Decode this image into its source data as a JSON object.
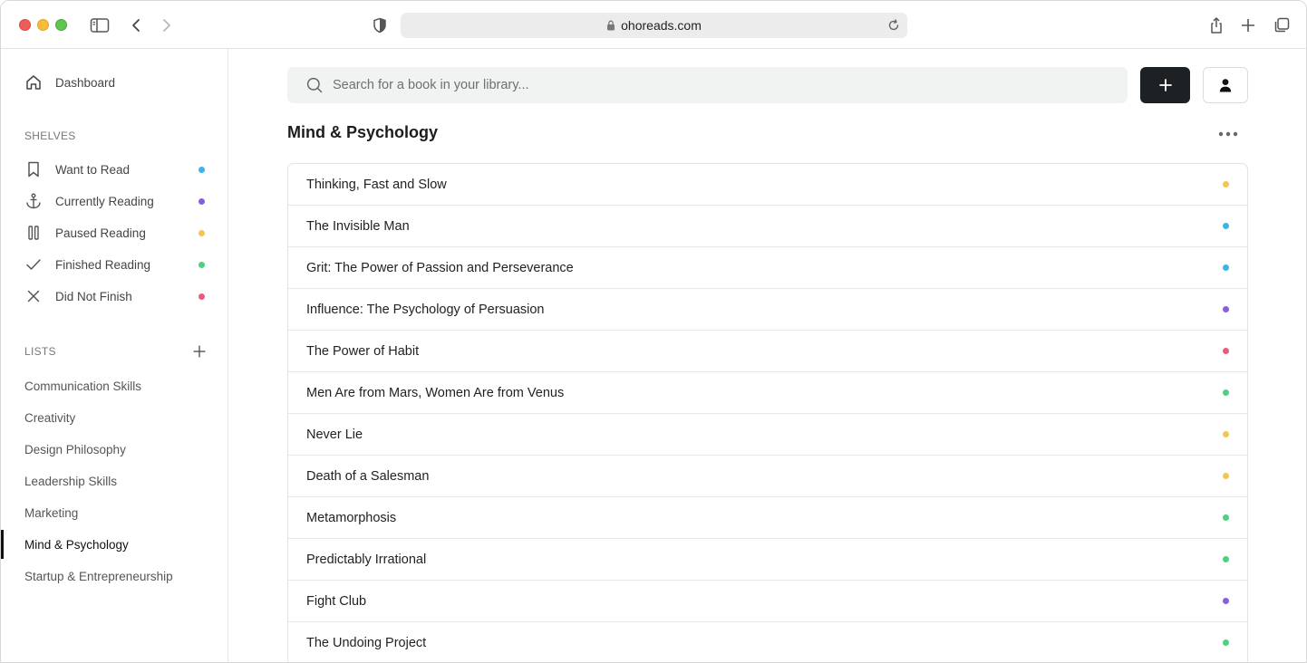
{
  "browser": {
    "url": "ohoreads.com"
  },
  "sidebar": {
    "dashboard_label": "Dashboard",
    "shelves_title": "SHELVES",
    "shelves": [
      {
        "label": "Want to Read",
        "icon": "bookmark-icon",
        "color": "#3ab5ea"
      },
      {
        "label": "Currently Reading",
        "icon": "anchor-icon",
        "color": "#8b5ce0"
      },
      {
        "label": "Paused Reading",
        "icon": "pause-icon",
        "color": "#f5c64f"
      },
      {
        "label": "Finished Reading",
        "icon": "check-icon",
        "color": "#4cd17f"
      },
      {
        "label": "Did Not Finish",
        "icon": "close-icon",
        "color": "#ea5a7e"
      }
    ],
    "lists_title": "LISTS",
    "lists": [
      {
        "label": "Communication Skills"
      },
      {
        "label": "Creativity"
      },
      {
        "label": "Design Philosophy"
      },
      {
        "label": "Leadership Skills"
      },
      {
        "label": "Marketing"
      },
      {
        "label": "Mind & Psychology",
        "active": true
      },
      {
        "label": "Startup & Entrepreneurship"
      }
    ]
  },
  "search": {
    "placeholder": "Search for a book in your library..."
  },
  "main": {
    "title": "Mind & Psychology",
    "books": [
      {
        "title": "Thinking, Fast and Slow",
        "color": "#f5c64f"
      },
      {
        "title": "The Invisible Man",
        "color": "#3ab5ea"
      },
      {
        "title": "Grit: The Power of Passion and Perseverance",
        "color": "#3ab5ea"
      },
      {
        "title": "Influence: The Psychology of Persuasion",
        "color": "#8b5ce0"
      },
      {
        "title": "The Power of Habit",
        "color": "#ea5a7e"
      },
      {
        "title": "Men Are from Mars, Women Are from Venus",
        "color": "#4cd17f"
      },
      {
        "title": "Never Lie",
        "color": "#f5c64f"
      },
      {
        "title": "Death of a Salesman",
        "color": "#f5c64f"
      },
      {
        "title": "Metamorphosis",
        "color": "#4cd17f"
      },
      {
        "title": "Predictably Irrational",
        "color": "#4cd17f"
      },
      {
        "title": "Fight Club",
        "color": "#8b5ce0"
      },
      {
        "title": "The Undoing Project",
        "color": "#4cd17f"
      }
    ]
  }
}
